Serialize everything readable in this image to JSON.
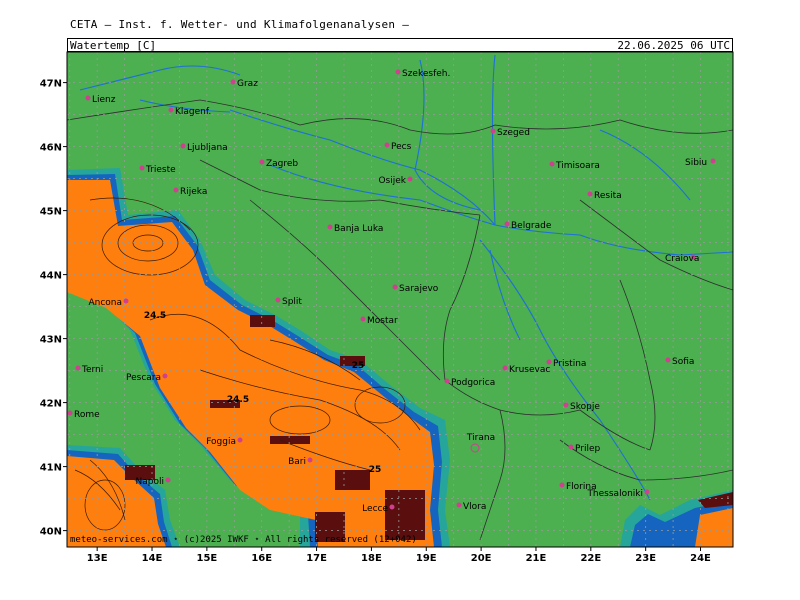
{
  "header": {
    "title": "CETA — Inst. f. Wetter- und Klimafolgenanalysen —",
    "variable": "Watertemp_[C]",
    "datetime": "22.06.2025 06 UTC"
  },
  "footer": {
    "copyright": "meteo-services.com ⋆ (c)2025 IWKF ⋆ All rights reserved (12+042)"
  },
  "axes": {
    "lat_labels": [
      "47N",
      "46N",
      "45N",
      "44N",
      "43N",
      "42N",
      "41N",
      "40N"
    ],
    "lon_labels": [
      "13E",
      "14E",
      "15E",
      "16E",
      "17E",
      "18E",
      "19E",
      "20E",
      "21E",
      "22E",
      "23E",
      "24E"
    ]
  },
  "colors": {
    "land": "#4caf50",
    "sea_warm": "#ff7f0e",
    "sea_hot": "#5a0e0e",
    "coast_blue": "#1565c0",
    "coast_cyan": "#26a69a",
    "rivers": "#1e6fd9",
    "cities": "#d04090"
  },
  "cities": [
    {
      "name": "Lienz"
    },
    {
      "name": "Graz"
    },
    {
      "name": "Szekesfeh."
    },
    {
      "name": "Klagenf."
    },
    {
      "name": "Ljubljana"
    },
    {
      "name": "Zagreb"
    },
    {
      "name": "Pecs"
    },
    {
      "name": "Szeged"
    },
    {
      "name": "Trieste"
    },
    {
      "name": "Rijeka"
    },
    {
      "name": "Osijek"
    },
    {
      "name": "Timisoara"
    },
    {
      "name": "Sibiu"
    },
    {
      "name": "Resita"
    },
    {
      "name": "Banja Luka"
    },
    {
      "name": "Belgrade"
    },
    {
      "name": "Craiova"
    },
    {
      "name": "Ancona"
    },
    {
      "name": "Split"
    },
    {
      "name": "Sarajevo"
    },
    {
      "name": "Mostar"
    },
    {
      "name": "Terni"
    },
    {
      "name": "Pescara"
    },
    {
      "name": "Podgorica"
    },
    {
      "name": "Krusevac"
    },
    {
      "name": "Pristina"
    },
    {
      "name": "Sofia"
    },
    {
      "name": "Rome"
    },
    {
      "name": "Skopje"
    },
    {
      "name": "Tirana"
    },
    {
      "name": "Foggia"
    },
    {
      "name": "Prilep"
    },
    {
      "name": "Bari"
    },
    {
      "name": "Napoli"
    },
    {
      "name": "Florina"
    },
    {
      "name": "Thessaloniki"
    },
    {
      "name": "Vlora"
    },
    {
      "name": "Lecce"
    }
  ],
  "contour_labels": [
    "24.5",
    "24.5",
    "25",
    "25"
  ]
}
